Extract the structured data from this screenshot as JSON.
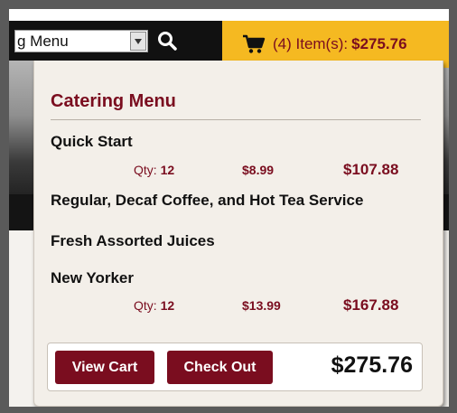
{
  "header": {
    "menu_select_value": "g Menu",
    "cart": {
      "count_text": "(4) Item(s):",
      "total": "$275.76"
    }
  },
  "dropdown": {
    "title": "Catering Menu",
    "items": [
      {
        "name": "Quick Start",
        "qty_label": "Qty:",
        "qty": "12",
        "unit_price": "$8.99",
        "line_total": "$107.88"
      },
      {
        "name": "Regular, Decaf Coffee, and Hot Tea Service"
      },
      {
        "name": "Fresh Assorted Juices"
      },
      {
        "name": "New Yorker",
        "qty_label": "Qty:",
        "qty": "12",
        "unit_price": "$13.99",
        "line_total": "$167.88"
      }
    ],
    "buttons": {
      "view_cart": "View Cart",
      "check_out": "Check Out"
    },
    "grand_total": "$275.76"
  },
  "colors": {
    "brand": "#7a0d1f",
    "cart_bar": "#f5b921",
    "header_bg": "#111111"
  },
  "icons": [
    "chevron-down-icon",
    "search-icon",
    "cart-icon"
  ]
}
